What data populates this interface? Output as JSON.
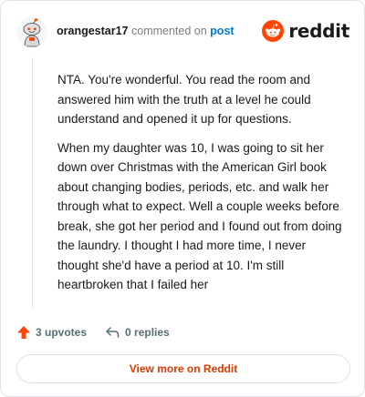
{
  "header": {
    "username": "orangestar17",
    "action_text": "commented on",
    "post_link": "post",
    "brand": "reddit"
  },
  "comment": {
    "paragraphs": [
      "NTA. You're wonderful. You read the room and answered him with the truth at a level he could understand and opened it up for questions.",
      "When my daughter was 10, I was going to sit her down over Christmas with the American Girl book about changing bodies, periods, etc. and walk her through what to expect. Well a couple weeks before break, she got her period and I found out from doing the laundry. I thought I had more time, I never thought she'd have a period at 10. I'm still heartbroken that I failed her"
    ]
  },
  "actions": {
    "upvotes": "3 upvotes",
    "replies": "0 replies"
  },
  "footer": {
    "view_more": "View more on Reddit"
  },
  "colors": {
    "brand": "#ff4500",
    "link": "#0079d3",
    "muted": "#576f76",
    "view_more_text": "#d93a00"
  },
  "icons": [
    "avatar-snoo",
    "reddit-logo-icon",
    "upvote-arrow-icon",
    "reply-arrow-icon"
  ]
}
